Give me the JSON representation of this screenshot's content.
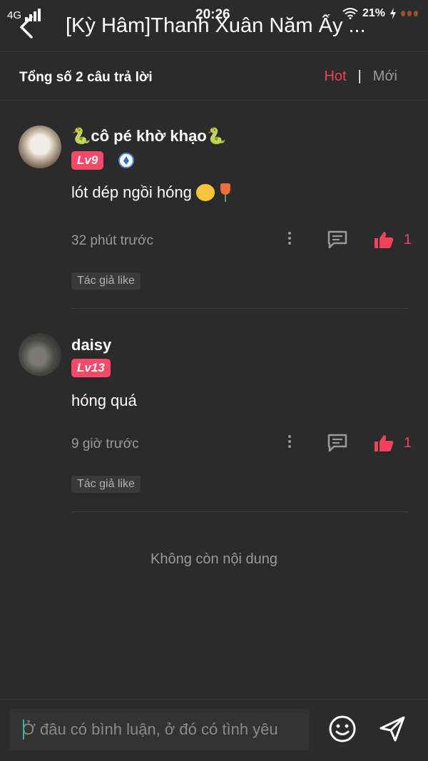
{
  "status_bar": {
    "network": "4G",
    "time": "20:26",
    "battery": "21%"
  },
  "header": {
    "title": "[Kỳ Hâm]Thanh Xuân Năm Ấy ..."
  },
  "subheader": {
    "total": "Tổng số 2 câu trả lời",
    "sort_hot": "Hot",
    "sort_separator": "|",
    "sort_new": "Mới"
  },
  "comments": [
    {
      "username": "🐍cô pé khờ khạo🐍",
      "level": "Lv9",
      "text": "lót dép ngồi hóng",
      "time": "32 phút trước",
      "likes": "1",
      "author_like": "Tác giả like"
    },
    {
      "username": "daisy",
      "level": "Lv13",
      "text": "hóng quá",
      "time": "9 giờ trước",
      "likes": "1",
      "author_like": "Tác giả like"
    }
  ],
  "no_more": "Không còn nội dung",
  "composer": {
    "placeholder": "Ở đâu có bình luận, ở đó có tình yêu"
  },
  "colors": {
    "background": "#2b2b2b",
    "accent": "#f2415a",
    "muted": "#9a9a9a"
  }
}
